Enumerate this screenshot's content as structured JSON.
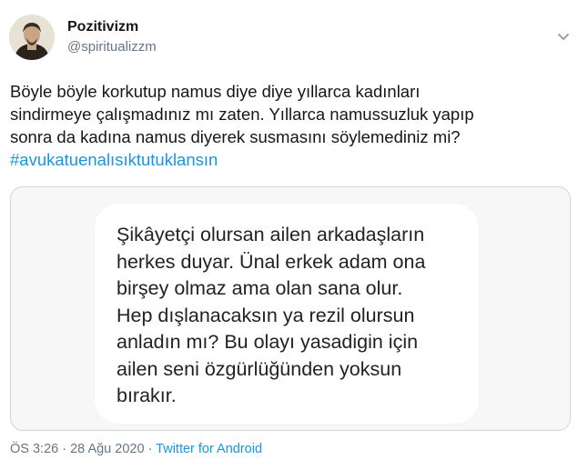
{
  "author": {
    "display_name": "Pozitivizm",
    "handle": "@spiritualizzm",
    "avatar_icon": "profile-photo"
  },
  "tweet": {
    "text": "Böyle böyle korkutup namus diye diye yıllarca kadınları\nsindirmeye çalışmadınız mı zaten. Yıllarca namussuzluk yapıp\nsonra da kadına namus diyerek susmasını söylemediniz mi?",
    "hashtag": "#avukatuenalısıktutuklansın"
  },
  "media": {
    "image_text": "Şikâyetçi olursan ailen arkadaşların\nherkes duyar. Ünal erkek adam ona\nbirşey olmaz ama olan sana olur.\nHep dışlanacaksın ya rezil olursun\nanladın mı? Bu olayı yasadigin için\nailen seni özgürlüğünden yoksun\nbırakır."
  },
  "meta": {
    "time": "ÖS 3:26",
    "separator1": " · ",
    "date": "28 Ağu 2020",
    "separator2": " · ",
    "source": "Twitter for Android"
  },
  "colors": {
    "link": "#1b95e0",
    "secondary_text": "#657786",
    "primary_text": "#14171a",
    "border": "#ccd6dd"
  }
}
